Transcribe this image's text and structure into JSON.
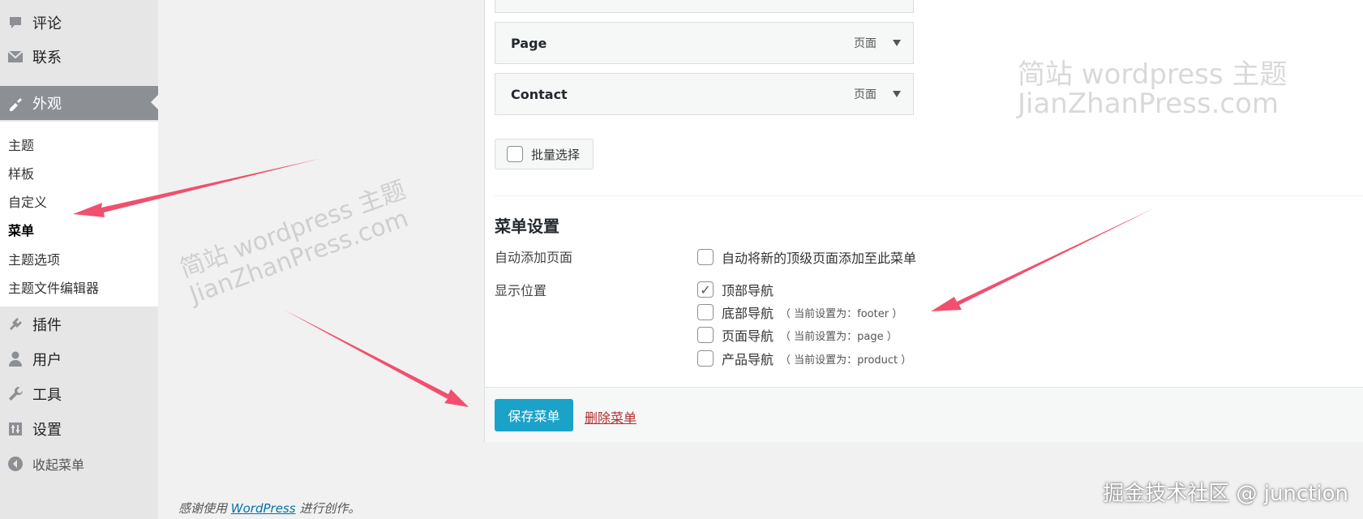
{
  "sidebar": {
    "items": [
      {
        "label": "评论",
        "icon": "comment-icon"
      },
      {
        "label": "联系",
        "icon": "mail-icon"
      },
      {
        "label": "外观",
        "icon": "appearance-icon"
      },
      {
        "label": "插件",
        "icon": "plugin-icon"
      },
      {
        "label": "用户",
        "icon": "user-icon"
      },
      {
        "label": "工具",
        "icon": "wrench-icon"
      },
      {
        "label": "设置",
        "icon": "settings-icon"
      }
    ],
    "submenu": [
      "主题",
      "样板",
      "自定义",
      "菜单",
      "主题选项",
      "主题文件编辑器"
    ],
    "collapse_label": "收起菜单"
  },
  "menu_items": [
    {
      "title": "Page",
      "type": "页面"
    },
    {
      "title": "Contact",
      "type": "页面"
    }
  ],
  "bulk_select_label": "批量选择",
  "menu_settings": {
    "title": "菜单设置",
    "auto_add_label": "自动添加页面",
    "auto_add_option": "自动将新的顶级页面添加至此菜单",
    "display_location_label": "显示位置",
    "locations": [
      {
        "label": "顶部导航",
        "note": "",
        "checked": true
      },
      {
        "label": "底部导航",
        "note": "（ 当前设置为：footer ）",
        "checked": false
      },
      {
        "label": "页面导航",
        "note": "（ 当前设置为：page ）",
        "checked": false
      },
      {
        "label": "产品导航",
        "note": "（ 当前设置为：product ）",
        "checked": false
      }
    ]
  },
  "actions": {
    "save_label": "保存菜单",
    "delete_label": "删除菜单"
  },
  "footer": {
    "prefix": "感谢使用",
    "link": "WordPress",
    "suffix": "进行创作。"
  },
  "watermarks": {
    "line1": "简站 wordpress 主题",
    "line2": "JianZhanPress.com",
    "juejin": "掘金技术社区 @ junction"
  },
  "colors": {
    "accent": "#1aa2c9",
    "danger": "#b32d2e",
    "arrow": "#f0506e"
  }
}
